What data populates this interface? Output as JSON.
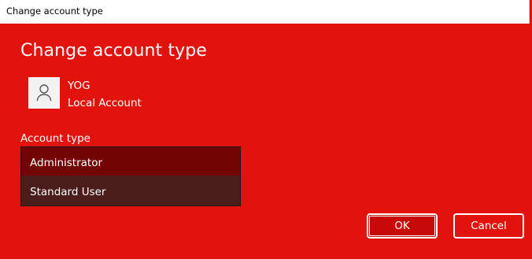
{
  "window": {
    "title": "Change account type"
  },
  "dialog": {
    "heading": "Change account type",
    "user": {
      "name": "YOG",
      "account_kind": "Local Account",
      "avatar_icon": "person-icon"
    },
    "account_type_label": "Account type",
    "options": [
      {
        "label": "Administrator",
        "selected": true
      },
      {
        "label": "Standard User",
        "selected": false
      }
    ],
    "ok_label": "OK",
    "cancel_label": "Cancel"
  },
  "colors": {
    "background": "#e2120d",
    "selected_option": "#720503",
    "unselected_option": "#4a1d1a",
    "ok_button": "#c70a08"
  }
}
